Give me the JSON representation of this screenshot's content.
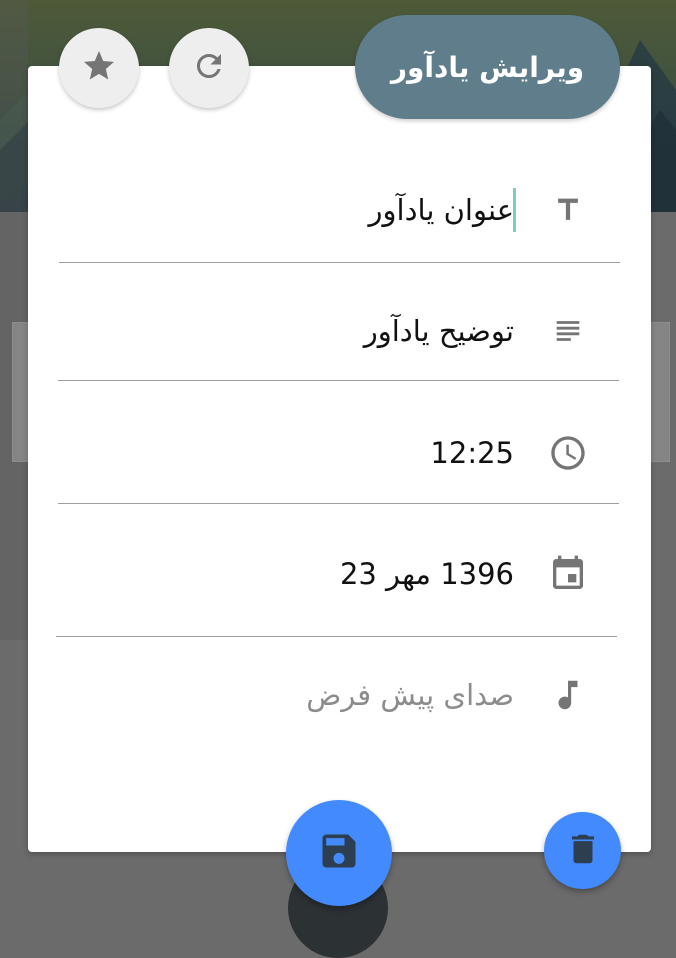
{
  "dialog": {
    "title": "ویرایش یادآور"
  },
  "toolbar": {
    "star_icon": "star-icon",
    "refresh_icon": "refresh-icon"
  },
  "fields": {
    "title": {
      "value": "عنوان یادآور",
      "icon": "text-title-icon"
    },
    "description": {
      "value": "توضیح یادآور",
      "icon": "notes-icon"
    },
    "time": {
      "value": "12:25",
      "icon": "clock-icon"
    },
    "date": {
      "value": "1396 مهر 23",
      "icon": "calendar-icon"
    },
    "sound": {
      "value": "صدای پیش فرض",
      "icon": "music-note-icon"
    }
  },
  "actions": {
    "save_icon": "save-icon",
    "delete_icon": "delete-icon"
  },
  "colors": {
    "accent": "#448aff",
    "title_pill": "#607d8b",
    "caret": "#80cbc4",
    "icon_gray": "#757575"
  }
}
